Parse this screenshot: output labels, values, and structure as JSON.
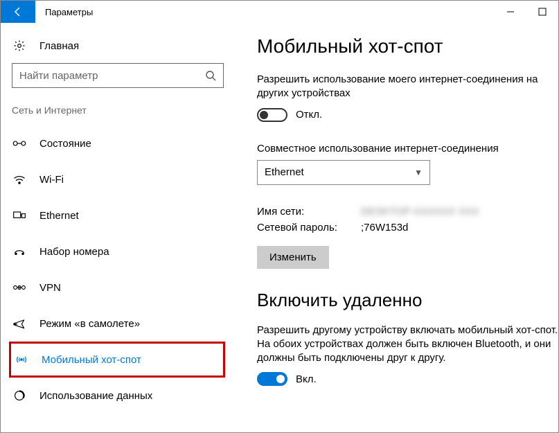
{
  "window": {
    "title": "Параметры"
  },
  "sidebar": {
    "home_label": "Главная",
    "search_placeholder": "Найти параметр",
    "category_label": "Сеть и Интернет",
    "items": [
      {
        "label": "Состояние"
      },
      {
        "label": "Wi-Fi"
      },
      {
        "label": "Ethernet"
      },
      {
        "label": "Набор номера"
      },
      {
        "label": "VPN"
      },
      {
        "label": "Режим «в самолете»"
      },
      {
        "label": "Мобильный хот-спот"
      },
      {
        "label": "Использование данных"
      }
    ]
  },
  "main": {
    "title": "Мобильный хот-спот",
    "share_desc": "Разрешить использование моего интернет-соединения на других устройствах",
    "share_toggle_state_label": "Откл.",
    "connection_label": "Совместное использование интернет-соединения",
    "connection_value": "Ethernet",
    "network_name_label": "Имя сети:",
    "network_name_value": "DESKTOP-XXXXXX XXX",
    "network_password_label": "Сетевой пароль:",
    "network_password_value": ";76W153d",
    "change_button_label": "Изменить",
    "remote_title": "Включить удаленно",
    "remote_desc": "Разрешить другому устройству включать мобильный хот-спот. На обоих устройствах должен быть включен Bluetooth, и они должны быть подключены друг к другу.",
    "remote_toggle_state_label": "Вкл."
  }
}
